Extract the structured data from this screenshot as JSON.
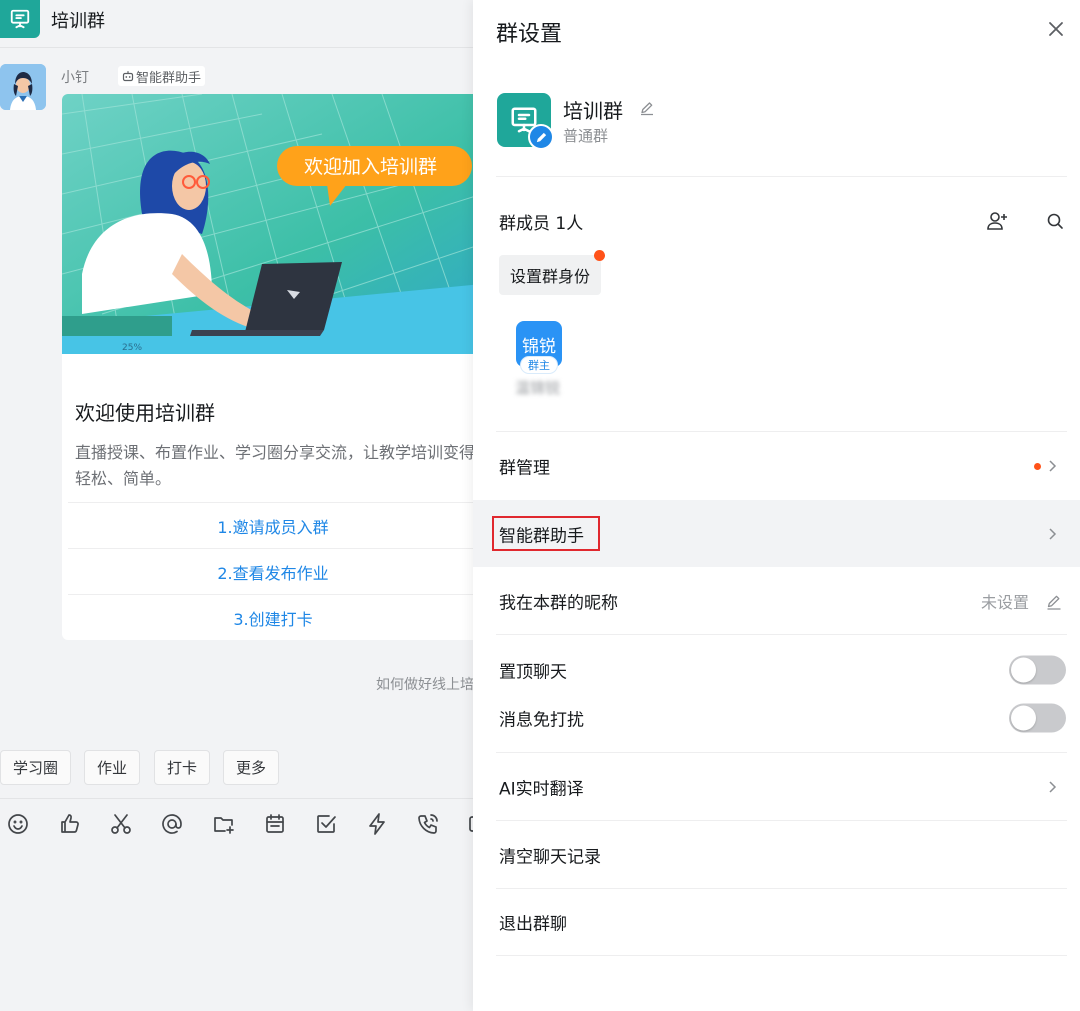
{
  "chat": {
    "title": "培训群",
    "sender": "小钉",
    "bot_tag": "智能群助手",
    "card": {
      "banner_text": "欢迎加入培训群",
      "title": "欢迎使用培训群",
      "description": "直播授课、布置作业、学习圈分享交流，让教学培训变得轻松、简单。",
      "links": [
        "1.邀请成员入群",
        "2.查看发布作业",
        "3.创建打卡"
      ]
    },
    "system_hint": "如何做好线上培训",
    "quick_buttons": [
      "学习圈",
      "作业",
      "打卡",
      "更多"
    ],
    "toolbar_icons": [
      "emoji-icon",
      "thumbs-up-icon",
      "scissors-icon",
      "at-icon",
      "folder-add-icon",
      "calendar-icon",
      "check-task-icon",
      "lightning-icon",
      "phone-icon"
    ]
  },
  "panel": {
    "title": "群设置",
    "group_name": "培训群",
    "group_type": "普通群",
    "members_label": "群成员 1人",
    "set_role_label": "设置群身份",
    "member": {
      "avatar_text": "锦锐",
      "badge": "群主",
      "name": "温锦锐"
    },
    "rows": {
      "manage": "群管理",
      "assistant": "智能群助手",
      "nickname": "我在本群的昵称",
      "nickname_value": "未设置",
      "pin": "置顶聊天",
      "dnd": "消息免打扰",
      "translate": "AI实时翻译",
      "clear": "清空聊天记录",
      "exit": "退出群聊"
    },
    "toggles": {
      "pin": false,
      "dnd": false
    }
  },
  "colors": {
    "accent": "#1f87e6",
    "group_icon": "#1fa79a",
    "notify_dot": "#ff5219",
    "highlight_box": "#e0282e"
  }
}
